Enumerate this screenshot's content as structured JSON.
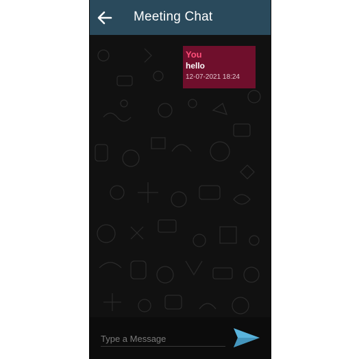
{
  "header": {
    "title": "Meeting Chat",
    "back_icon": "arrow-left-icon"
  },
  "messages": [
    {
      "sender": "You",
      "text": "hello",
      "timestamp": "12-07-2021 18:24"
    }
  ],
  "composer": {
    "placeholder": "Type a Message",
    "value": "",
    "send_icon": "send-icon"
  },
  "colors": {
    "toolbar": "#2a4a5c",
    "background": "#111111",
    "bubble": "#6f0f2c",
    "sender": "#ff4f7a",
    "send": "#5ab4dc"
  }
}
